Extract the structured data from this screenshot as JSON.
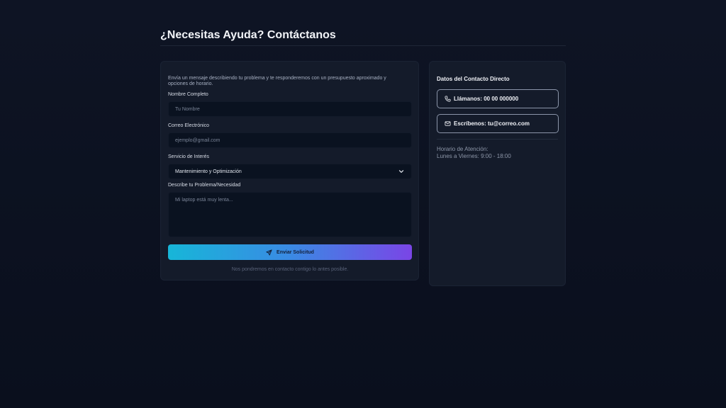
{
  "header": {
    "title": "¿Necesitas Ayuda? Contáctanos"
  },
  "form": {
    "intro": "Envía un mensaje describiendo tu problema y te responderemos con un presupuesto aproximado y opciones de horario.",
    "name": {
      "label": "Nombre Completo",
      "placeholder": "Tu Nombre"
    },
    "email": {
      "label": "Correo Electrónico",
      "placeholder": "ejemplo@gmail.com"
    },
    "service": {
      "label": "Servicio de Interés",
      "selected": "Mantenimiento y Optimización"
    },
    "problem": {
      "label": "Describe tu Problema/Necesidad",
      "placeholder": "Mi laptop está muy lenta..."
    },
    "submit_label": "Enviar Solicitud",
    "note": "Nos pondremos en contacto contigo lo antes posible."
  },
  "contact": {
    "title": "Datos del Contacto Directo",
    "phone_label": "Llámanos: 00 00 000000",
    "email_label": "Escríbenos: tu@correo.com",
    "hours_label": "Horario de Atención:",
    "hours_value": "Lunes a Viernes: 9:00 - 18:00"
  },
  "icons": {
    "phone": "phone-icon",
    "mail": "mail-icon",
    "send": "send-icon",
    "chevron": "chevron-down-icon"
  },
  "colors": {
    "background": "#0b1020",
    "card": "#141b2a",
    "field": "#0a1220",
    "gradient_start": "#17b6d8",
    "gradient_end": "#7a45e6"
  }
}
